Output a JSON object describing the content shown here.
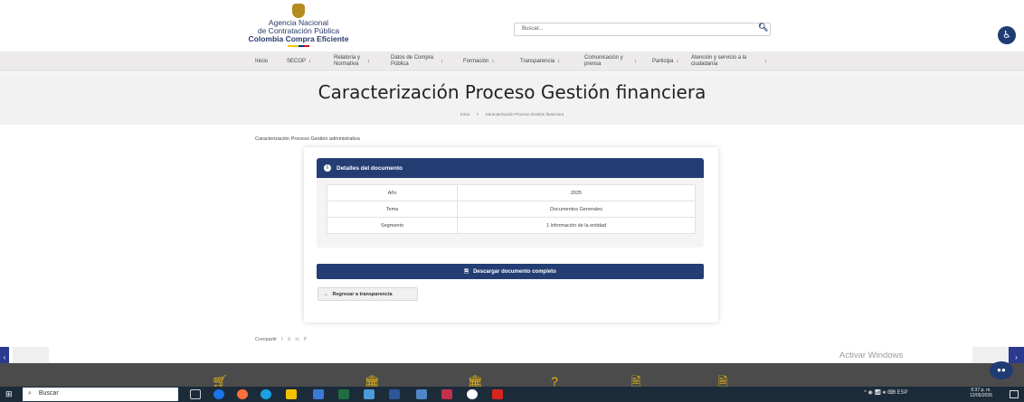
{
  "header": {
    "logo": {
      "line1": "Agencia Nacional",
      "line2": "de Contratación Pública",
      "line3": "Colombia Compra Eficiente"
    },
    "search": {
      "placeholder": "Buscar...",
      "icon": "search-icon"
    },
    "accessibility_icon": "accessibility-icon"
  },
  "nav": {
    "items": [
      {
        "label": "Inicio",
        "has_arrow": false
      },
      {
        "label": "SECOP",
        "has_arrow": true
      },
      {
        "label": "Relatoría y Normativa",
        "has_arrow": true
      },
      {
        "label": "Datos de Compra Pública",
        "has_arrow": true
      },
      {
        "label": "Formación",
        "has_arrow": true
      },
      {
        "label": "Transparencia",
        "has_arrow": true
      },
      {
        "label": "Comunicación y prensa",
        "has_arrow": true
      },
      {
        "label": "Participa",
        "has_arrow": true
      },
      {
        "label": "Atención y servicio a la ciudadanía",
        "has_arrow": true
      }
    ],
    "arrow": "↓"
  },
  "hero": {
    "title": "Caracterización Proceso Gestión financiera",
    "breadcrumb": [
      "Inicio",
      ">",
      "Caracterización Proceso Gestión financiera"
    ]
  },
  "sub_label": "Caracterización Proceso Gestión administrativa",
  "document": {
    "header": "Detalles del documento",
    "rows": [
      {
        "key": "Año",
        "value": "2025"
      },
      {
        "key": "Tema",
        "value": "Documentos Generales"
      },
      {
        "key": "Segmento",
        "value": "1 Información de la entidad"
      }
    ],
    "download_label": "Descargar documento completo",
    "back_label": "Regresar a transparencia"
  },
  "share": {
    "label": "Compartir",
    "icons": [
      "f",
      "X",
      "in",
      "P"
    ]
  },
  "watermark": "Activar Windows",
  "taskbar": {
    "search_label": "Buscar",
    "lang": "ESP",
    "time": "6:37 p. m.",
    "date": "12/05/2026"
  },
  "colors": {
    "primary": "#243d73",
    "nav_bg": "#eceaea",
    "hero_bg": "#f2f2f2",
    "footer": "#4b4b4b"
  }
}
